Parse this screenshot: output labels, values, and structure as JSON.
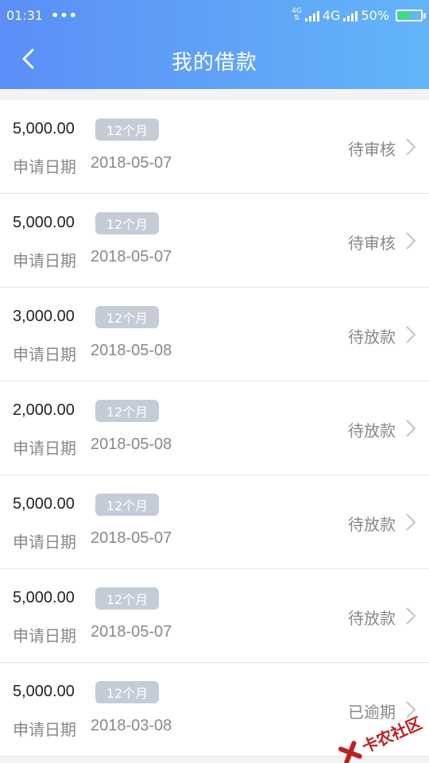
{
  "status_bar": {
    "time": "01:31",
    "dots": "•••",
    "network_small": "4G",
    "network": "4G",
    "battery": "50%"
  },
  "nav": {
    "title": "我的借款"
  },
  "loans": [
    {
      "amount": "5,000.00",
      "term": "12个月",
      "date_label": "申请日期",
      "date": "2018-05-07",
      "status": "待审核"
    },
    {
      "amount": "5,000.00",
      "term": "12个月",
      "date_label": "申请日期",
      "date": "2018-05-07",
      "status": "待审核"
    },
    {
      "amount": "3,000.00",
      "term": "12个月",
      "date_label": "申请日期",
      "date": "2018-05-08",
      "status": "待放款"
    },
    {
      "amount": "2,000.00",
      "term": "12个月",
      "date_label": "申请日期",
      "date": "2018-05-08",
      "status": "待放款"
    },
    {
      "amount": "5,000.00",
      "term": "12个月",
      "date_label": "申请日期",
      "date": "2018-05-07",
      "status": "待放款"
    },
    {
      "amount": "5,000.00",
      "term": "12个月",
      "date_label": "申请日期",
      "date": "2018-05-07",
      "status": "待放款"
    },
    {
      "amount": "5,000.00",
      "term": "12个月",
      "date_label": "申请日期",
      "date": "2018-03-08",
      "status": "已逾期"
    }
  ],
  "watermark": {
    "text": "卡农社区"
  },
  "colors": {
    "header_start": "#5b8ef7",
    "header_end": "#63b5f8",
    "badge": "#c5ccd8",
    "watermark": "#bb2222"
  }
}
